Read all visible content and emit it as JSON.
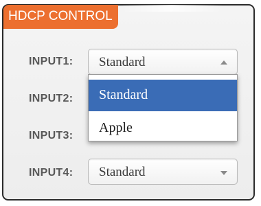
{
  "panel": {
    "title": "HDCP CONTROL"
  },
  "rows": [
    {
      "label": "INPUT1:",
      "value": "Standard",
      "open": true
    },
    {
      "label": "INPUT2:"
    },
    {
      "label": "INPUT3:"
    },
    {
      "label": "INPUT4:",
      "value": "Standard",
      "open": false
    }
  ],
  "dropdown": {
    "options": [
      "Standard",
      "Apple"
    ],
    "highlighted": "Standard"
  },
  "colors": {
    "title_bg": "#ec6f2f",
    "highlight": "#3a6cb6",
    "label_text": "#585858"
  }
}
